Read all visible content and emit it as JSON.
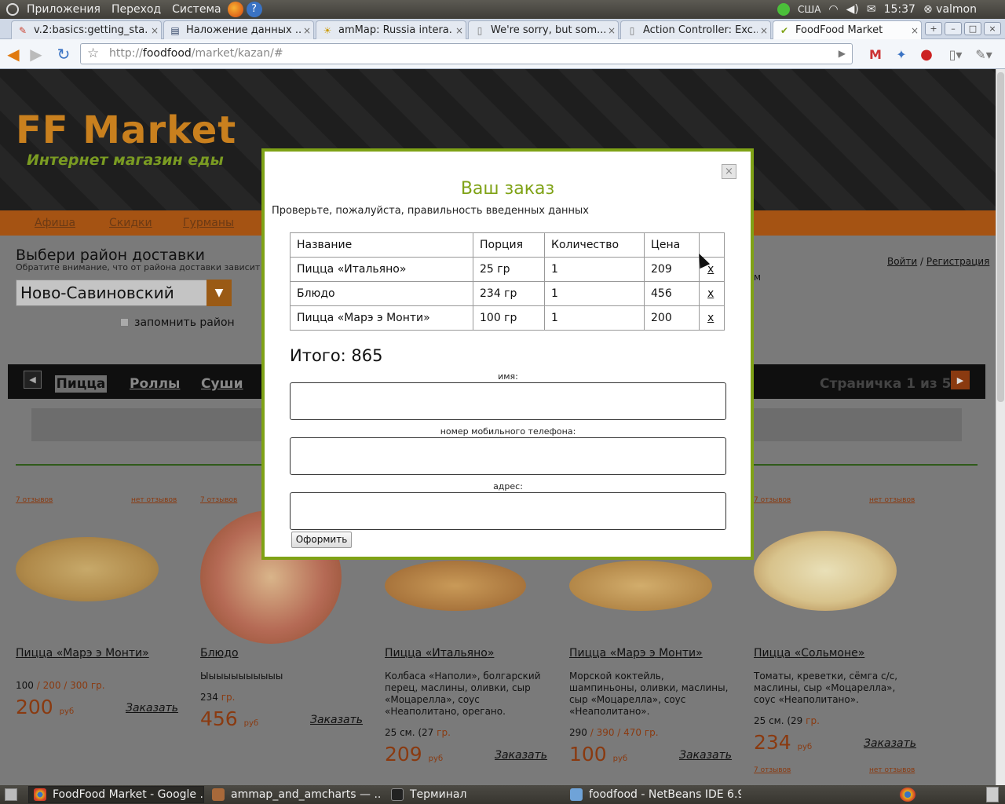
{
  "panel": {
    "menu": [
      "Приложения",
      "Переход",
      "Система"
    ],
    "keyboard": "США",
    "time": "15:37",
    "user": "valmon"
  },
  "tabs": [
    {
      "title": "v.2:basics:getting_sta...",
      "close": "×"
    },
    {
      "title": "Наложение данных ...",
      "close": "×"
    },
    {
      "title": "amMap: Russia intera...",
      "close": "×"
    },
    {
      "title": "We're sorry, but som...",
      "close": "×"
    },
    {
      "title": "Action Controller: Exc...",
      "close": "×"
    },
    {
      "title": "FoodFood Market",
      "close": "×"
    }
  ],
  "url": {
    "scheme": "http://",
    "host": "foodfood",
    "path": "/market/kazan/#"
  },
  "site": {
    "logo": "FF Market",
    "slogan": "Интернет магазин еды",
    "nav": [
      "Афиша",
      "Скидки",
      "Гурманы"
    ],
    "district_title": "Выбери район доставки",
    "district_note": "Обратите внимание, что от района доставки зависит м",
    "district_value": "Ново-Савиновский",
    "remember": "запомнить район",
    "login": "Войти",
    "register": "Регистрация",
    "m_letter": "м",
    "categories": [
      "Пицца",
      "Роллы",
      "Суши"
    ],
    "page_info": "Страничка 1 из 5"
  },
  "products": [
    {
      "reviews": "7 отзывов",
      "no_reviews": "нет отзывов",
      "name": "Пицца «Марэ э Монти»",
      "desc": "",
      "weight": "100",
      "weight_alt": " / 200 / 300 гр.",
      "price": "200",
      "cur": "руб",
      "order": "Заказать"
    },
    {
      "reviews": "7 отзывов",
      "no_reviews": "",
      "name": "Блюдо",
      "desc": "Ыыыыыыыыыыы",
      "weight": "234",
      "weight_alt": " гр.",
      "price": "456",
      "cur": "руб",
      "order": "Заказать"
    },
    {
      "reviews": "",
      "no_reviews": "",
      "name": "Пицца «Итальяно»",
      "desc": "Колбаса «Наполи», болгарский перец, маслины, оливки, сыр «Моцарелла», соус «Неаполитано, орегано.",
      "weight": "25 см. (27",
      "weight_alt": " гр.",
      "price": "209",
      "cur": "руб",
      "order": "Заказать"
    },
    {
      "reviews": "",
      "no_reviews": "",
      "name": "Пицца «Марэ э Монти»",
      "desc": "Морской коктейль, шампиньоны, оливки, маслины, сыр «Моцарелла», соус «Неаполитано».",
      "weight": "290",
      "weight_alt": " / 390 / 470 гр.",
      "price": "100",
      "cur": "руб",
      "order": "Заказать"
    },
    {
      "reviews": "7 отзывов",
      "no_reviews": "нет отзывов",
      "name": "Пицца «Сольмоне»",
      "desc": "Томаты, креветки, сёмга с/с, маслины, сыр «Моцарелла», соус «Неаполитано».",
      "weight": "25 см. (29",
      "weight_alt": " гр.",
      "price": "234",
      "cur": "руб",
      "order": "Заказать",
      "reviews2": "7 отзывов",
      "no_reviews2": "нет отзывов"
    }
  ],
  "modal": {
    "close": "×",
    "title": "Ваш заказ",
    "subtitle": "Проверьте, пожалуйста, правильность введенных данных",
    "headers": [
      "Название",
      "Порция",
      "Количество",
      "Цена"
    ],
    "rows": [
      {
        "name": "Пицца «Итальяно»",
        "portion": "25 гр",
        "qty": "1",
        "price": "209",
        "remove": "x"
      },
      {
        "name": "Блюдо",
        "portion": "234 гр",
        "qty": "1",
        "price": "456",
        "remove": "x"
      },
      {
        "name": "Пицца «Марэ э Монти»",
        "portion": "100 гр",
        "qty": "1",
        "price": "200",
        "remove": "x"
      }
    ],
    "total": "Итого: 865",
    "name_label": "имя:",
    "phone_label": "номер мобильного телефона:",
    "address_label": "адрес:",
    "submit": "Оформить"
  },
  "taskbar": [
    "FoodFood Market - Google ...",
    "ammap_and_amcharts — ...",
    "Терминал",
    "foodfood - NetBeans IDE 6.9"
  ],
  "colors": {
    "accent_green": "#7fa216",
    "brand_orange": "#c9801e",
    "price": "#8a3a10"
  }
}
